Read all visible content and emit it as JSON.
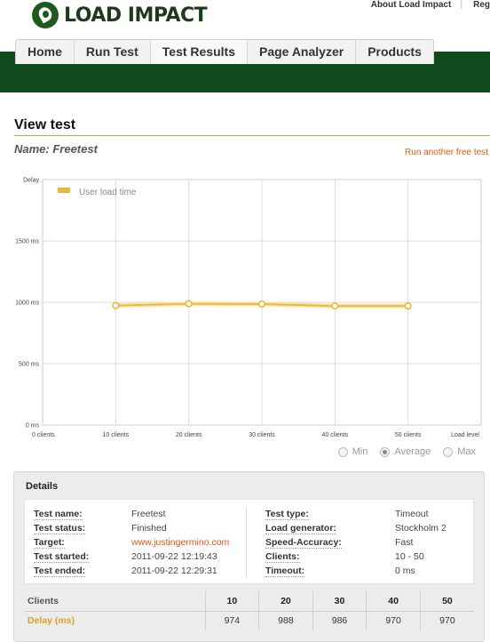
{
  "header": {
    "logo_text": "LOAD IMPACT",
    "links": [
      "About Load Impact",
      "Reg"
    ]
  },
  "nav": {
    "tabs": [
      "Home",
      "Run Test",
      "Test Results",
      "Page Analyzer",
      "Products"
    ],
    "active": "Test Results"
  },
  "page": {
    "title": "View test",
    "name_line": "Name: Freetest",
    "run_another": "Run another free test"
  },
  "chart_data": {
    "type": "line",
    "title": "",
    "ylabel": "Delay",
    "xlabel": "Load level",
    "x": [
      10,
      20,
      30,
      40,
      50
    ],
    "x_tick_labels": [
      "0 clients",
      "10 clients",
      "20 clients",
      "30 clients",
      "40 clients",
      "50 clients",
      "Load level"
    ],
    "y_tick_labels": [
      "0 ms",
      "500 ms",
      "1000 ms",
      "1500 ms",
      "Delay"
    ],
    "ylim": [
      0,
      2000
    ],
    "xlim": [
      0,
      60
    ],
    "grid": true,
    "legend_position": "top-left",
    "series": [
      {
        "name": "User load time",
        "values": [
          974,
          988,
          986,
          970,
          970
        ],
        "color": "#e8b838"
      }
    ]
  },
  "view_options": {
    "options": [
      "Min",
      "Average",
      "Max"
    ],
    "selected": "Average"
  },
  "details": {
    "title": "Details",
    "left": [
      {
        "label": "Test name:",
        "value": "Freetest"
      },
      {
        "label": "Test status:",
        "value": "Finished"
      },
      {
        "label": "Target:",
        "value": "www.justingermino.com"
      },
      {
        "label": "Test started:",
        "value": "2011-09-22 12:19:43"
      },
      {
        "label": "Test ended:",
        "value": "2011-09-22 12:29:31"
      }
    ],
    "right": [
      {
        "label": "Test type:",
        "value": "Timeout"
      },
      {
        "label": "Load generator:",
        "value": "Stockholm 2"
      },
      {
        "label": "Speed-Accuracy:",
        "value": "Fast"
      },
      {
        "label": "Clients:",
        "value": "10 - 50"
      },
      {
        "label": "Timeout:",
        "value": "0 ms"
      }
    ],
    "table": {
      "row_labels": [
        "Clients",
        "Delay (ms)"
      ],
      "clients": [
        "10",
        "20",
        "30",
        "40",
        "50"
      ],
      "delay": [
        "974",
        "988",
        "986",
        "970",
        "970"
      ]
    }
  },
  "colors": {
    "brand_green": "#0f4a1d",
    "accent_orange": "#e05a12",
    "series_yellow": "#e8b838"
  }
}
